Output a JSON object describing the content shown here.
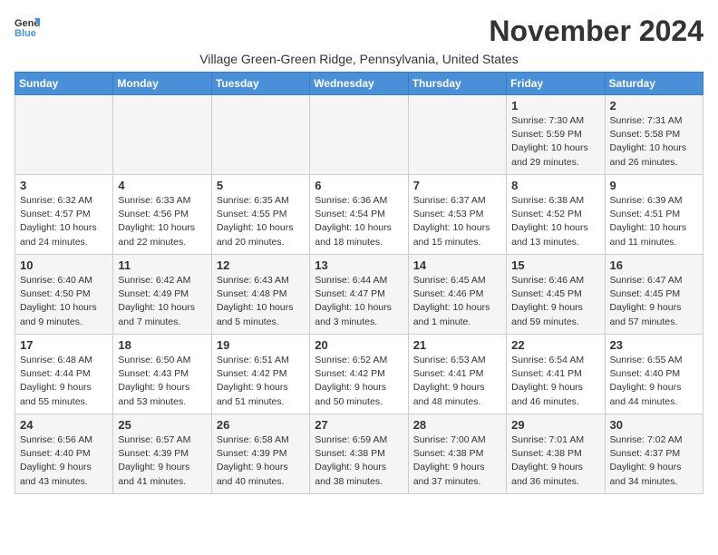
{
  "logo": {
    "general": "General",
    "blue": "Blue"
  },
  "title": "November 2024",
  "subtitle": "Village Green-Green Ridge, Pennsylvania, United States",
  "days_of_week": [
    "Sunday",
    "Monday",
    "Tuesday",
    "Wednesday",
    "Thursday",
    "Friday",
    "Saturday"
  ],
  "weeks": [
    [
      {
        "day": "",
        "info": ""
      },
      {
        "day": "",
        "info": ""
      },
      {
        "day": "",
        "info": ""
      },
      {
        "day": "",
        "info": ""
      },
      {
        "day": "",
        "info": ""
      },
      {
        "day": "1",
        "info": "Sunrise: 7:30 AM\nSunset: 5:59 PM\nDaylight: 10 hours and 29 minutes."
      },
      {
        "day": "2",
        "info": "Sunrise: 7:31 AM\nSunset: 5:58 PM\nDaylight: 10 hours and 26 minutes."
      }
    ],
    [
      {
        "day": "3",
        "info": "Sunrise: 6:32 AM\nSunset: 4:57 PM\nDaylight: 10 hours and 24 minutes."
      },
      {
        "day": "4",
        "info": "Sunrise: 6:33 AM\nSunset: 4:56 PM\nDaylight: 10 hours and 22 minutes."
      },
      {
        "day": "5",
        "info": "Sunrise: 6:35 AM\nSunset: 4:55 PM\nDaylight: 10 hours and 20 minutes."
      },
      {
        "day": "6",
        "info": "Sunrise: 6:36 AM\nSunset: 4:54 PM\nDaylight: 10 hours and 18 minutes."
      },
      {
        "day": "7",
        "info": "Sunrise: 6:37 AM\nSunset: 4:53 PM\nDaylight: 10 hours and 15 minutes."
      },
      {
        "day": "8",
        "info": "Sunrise: 6:38 AM\nSunset: 4:52 PM\nDaylight: 10 hours and 13 minutes."
      },
      {
        "day": "9",
        "info": "Sunrise: 6:39 AM\nSunset: 4:51 PM\nDaylight: 10 hours and 11 minutes."
      }
    ],
    [
      {
        "day": "10",
        "info": "Sunrise: 6:40 AM\nSunset: 4:50 PM\nDaylight: 10 hours and 9 minutes."
      },
      {
        "day": "11",
        "info": "Sunrise: 6:42 AM\nSunset: 4:49 PM\nDaylight: 10 hours and 7 minutes."
      },
      {
        "day": "12",
        "info": "Sunrise: 6:43 AM\nSunset: 4:48 PM\nDaylight: 10 hours and 5 minutes."
      },
      {
        "day": "13",
        "info": "Sunrise: 6:44 AM\nSunset: 4:47 PM\nDaylight: 10 hours and 3 minutes."
      },
      {
        "day": "14",
        "info": "Sunrise: 6:45 AM\nSunset: 4:46 PM\nDaylight: 10 hours and 1 minute."
      },
      {
        "day": "15",
        "info": "Sunrise: 6:46 AM\nSunset: 4:45 PM\nDaylight: 9 hours and 59 minutes."
      },
      {
        "day": "16",
        "info": "Sunrise: 6:47 AM\nSunset: 4:45 PM\nDaylight: 9 hours and 57 minutes."
      }
    ],
    [
      {
        "day": "17",
        "info": "Sunrise: 6:48 AM\nSunset: 4:44 PM\nDaylight: 9 hours and 55 minutes."
      },
      {
        "day": "18",
        "info": "Sunrise: 6:50 AM\nSunset: 4:43 PM\nDaylight: 9 hours and 53 minutes."
      },
      {
        "day": "19",
        "info": "Sunrise: 6:51 AM\nSunset: 4:42 PM\nDaylight: 9 hours and 51 minutes."
      },
      {
        "day": "20",
        "info": "Sunrise: 6:52 AM\nSunset: 4:42 PM\nDaylight: 9 hours and 50 minutes."
      },
      {
        "day": "21",
        "info": "Sunrise: 6:53 AM\nSunset: 4:41 PM\nDaylight: 9 hours and 48 minutes."
      },
      {
        "day": "22",
        "info": "Sunrise: 6:54 AM\nSunset: 4:41 PM\nDaylight: 9 hours and 46 minutes."
      },
      {
        "day": "23",
        "info": "Sunrise: 6:55 AM\nSunset: 4:40 PM\nDaylight: 9 hours and 44 minutes."
      }
    ],
    [
      {
        "day": "24",
        "info": "Sunrise: 6:56 AM\nSunset: 4:40 PM\nDaylight: 9 hours and 43 minutes."
      },
      {
        "day": "25",
        "info": "Sunrise: 6:57 AM\nSunset: 4:39 PM\nDaylight: 9 hours and 41 minutes."
      },
      {
        "day": "26",
        "info": "Sunrise: 6:58 AM\nSunset: 4:39 PM\nDaylight: 9 hours and 40 minutes."
      },
      {
        "day": "27",
        "info": "Sunrise: 6:59 AM\nSunset: 4:38 PM\nDaylight: 9 hours and 38 minutes."
      },
      {
        "day": "28",
        "info": "Sunrise: 7:00 AM\nSunset: 4:38 PM\nDaylight: 9 hours and 37 minutes."
      },
      {
        "day": "29",
        "info": "Sunrise: 7:01 AM\nSunset: 4:38 PM\nDaylight: 9 hours and 36 minutes."
      },
      {
        "day": "30",
        "info": "Sunrise: 7:02 AM\nSunset: 4:37 PM\nDaylight: 9 hours and 34 minutes."
      }
    ]
  ]
}
